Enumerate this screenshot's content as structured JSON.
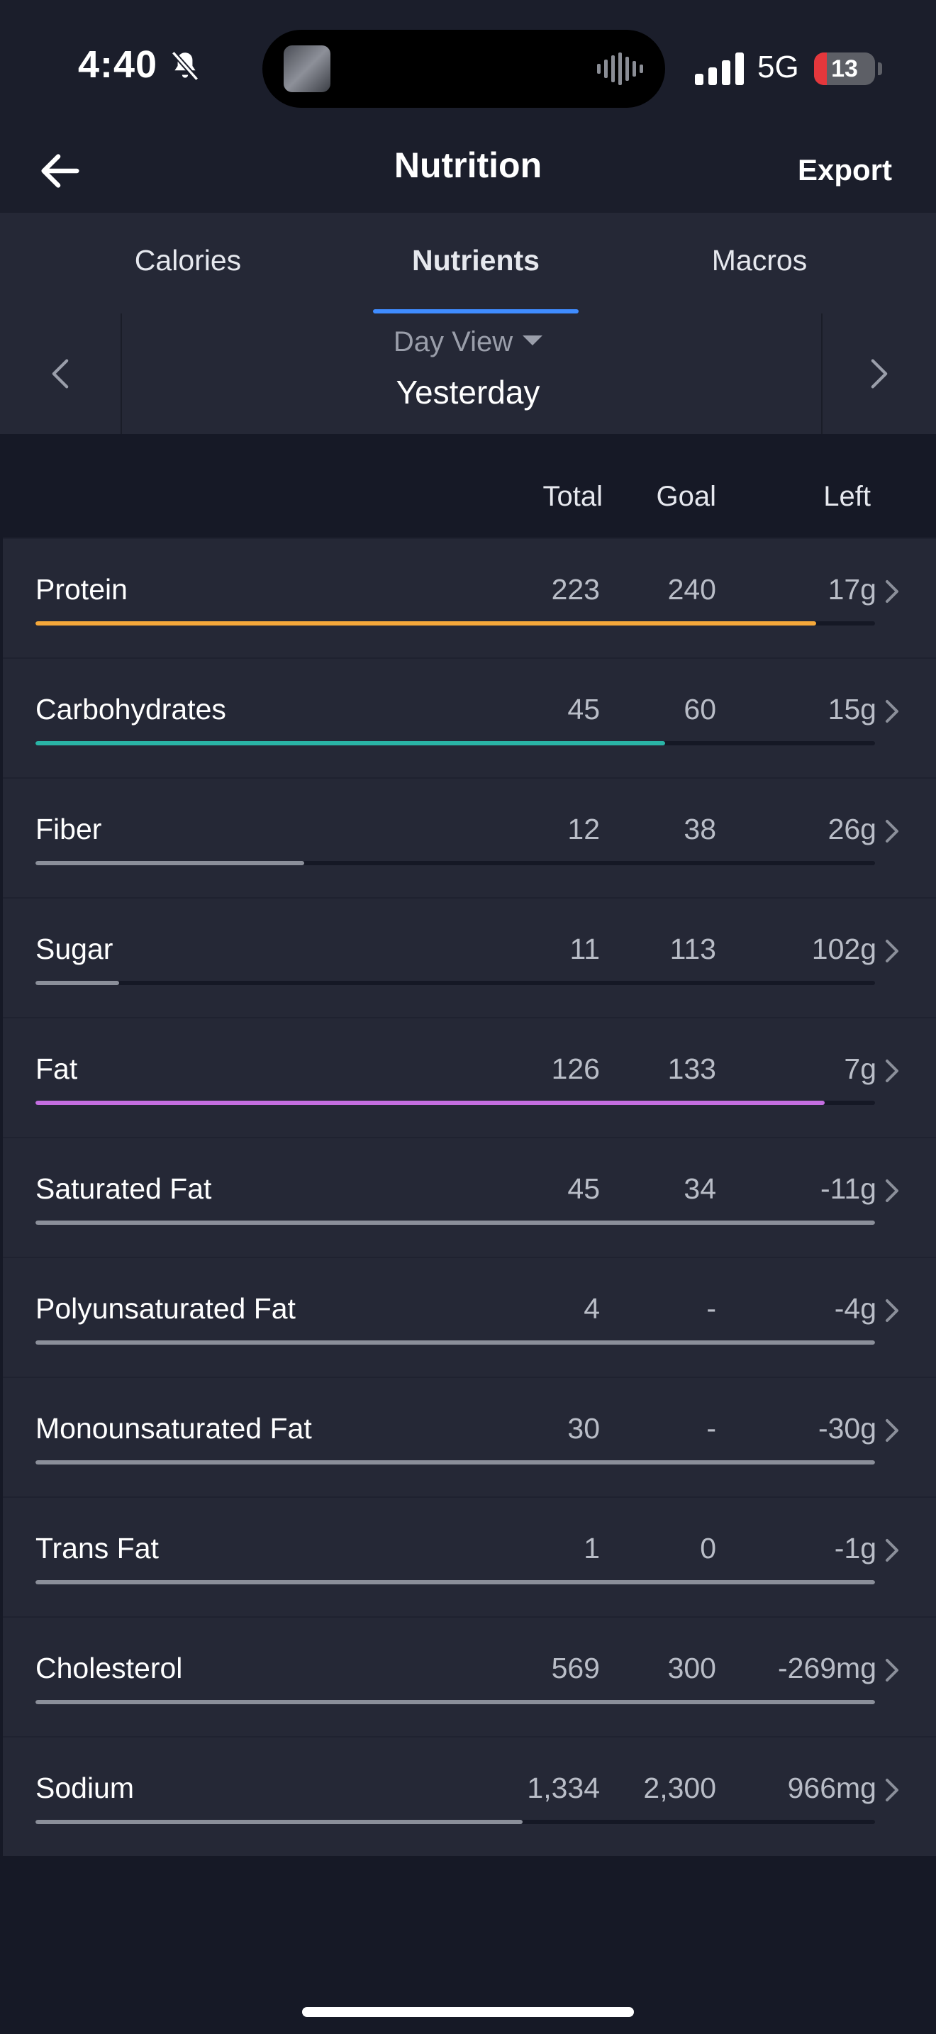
{
  "status_bar": {
    "time": "4:40",
    "network": "5G",
    "battery": "13"
  },
  "nav": {
    "title": "Nutrition",
    "export_label": "Export"
  },
  "tabs": [
    {
      "label": "Calories",
      "active": false
    },
    {
      "label": "Nutrients",
      "active": true
    },
    {
      "label": "Macros",
      "active": false
    }
  ],
  "date": {
    "view_label": "Day View",
    "day_label": "Yesterday"
  },
  "table": {
    "headers": {
      "total": "Total",
      "goal": "Goal",
      "left": "Left"
    },
    "rows": [
      {
        "name": "Protein",
        "total": "223",
        "goal": "240",
        "left": "17g",
        "progress": 0.93,
        "color": "#f5a83a"
      },
      {
        "name": "Carbohydrates",
        "total": "45",
        "goal": "60",
        "left": "15g",
        "progress": 0.75,
        "color": "#2ab4a6"
      },
      {
        "name": "Fiber",
        "total": "12",
        "goal": "38",
        "left": "26g",
        "progress": 0.32,
        "color": "#8b8f9a"
      },
      {
        "name": "Sugar",
        "total": "11",
        "goal": "113",
        "left": "102g",
        "progress": 0.1,
        "color": "#8b8f9a"
      },
      {
        "name": "Fat",
        "total": "126",
        "goal": "133",
        "left": "7g",
        "progress": 0.94,
        "color": "#c46ee0"
      },
      {
        "name": "Saturated Fat",
        "total": "45",
        "goal": "34",
        "left": "-11g",
        "progress": 1.0,
        "color": "#8b8f9a"
      },
      {
        "name": "Polyunsaturated Fat",
        "total": "4",
        "goal": "-",
        "left": "-4g",
        "progress": 1.0,
        "color": "#8b8f9a"
      },
      {
        "name": "Monounsaturated Fat",
        "total": "30",
        "goal": "-",
        "left": "-30g",
        "progress": 1.0,
        "color": "#8b8f9a"
      },
      {
        "name": "Trans Fat",
        "total": "1",
        "goal": "0",
        "left": "-1g",
        "progress": 1.0,
        "color": "#8b8f9a"
      },
      {
        "name": "Cholesterol",
        "total": "569",
        "goal": "300",
        "left": "-269mg",
        "progress": 1.0,
        "color": "#8b8f9a"
      },
      {
        "name": "Sodium",
        "total": "1,334",
        "goal": "2,300",
        "left": "966mg",
        "progress": 0.58,
        "color": "#8b8f9a"
      }
    ]
  },
  "icons": {
    "back": "arrow-left-icon",
    "prev": "chevron-left-icon",
    "next": "chevron-right-icon",
    "row_chevron": "chevron-right-icon",
    "bell": "bell-slash-icon"
  },
  "colors": {
    "accent": "#3f8cff",
    "background": "#161926",
    "panel": "#252836"
  }
}
